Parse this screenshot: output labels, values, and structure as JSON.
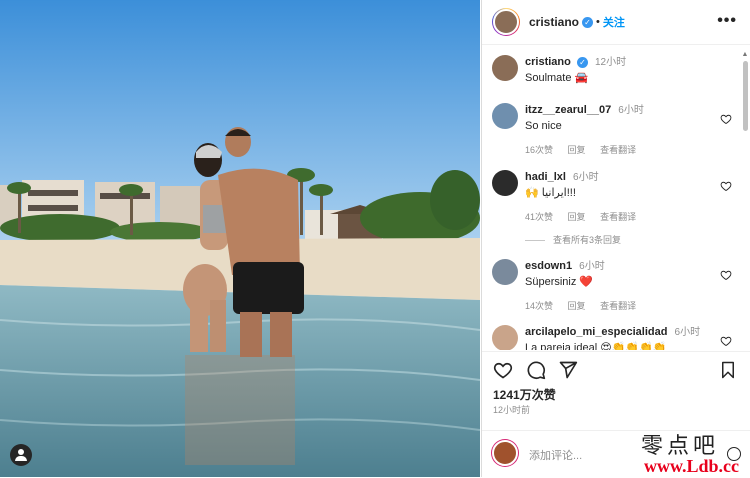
{
  "header": {
    "username": "cristiano",
    "separator": "•",
    "follow_label": "关注",
    "more_icon": "more-horizontal-icon"
  },
  "caption": {
    "username": "cristiano",
    "time": "12小时",
    "text": "Soulmate 🚘"
  },
  "comments": [
    {
      "username": "itzz__zearul__07",
      "time": "6小时",
      "text": "So nice",
      "likes": "16次赞",
      "reply": "回复",
      "translate": "查看翻译"
    },
    {
      "username": "hadi_lxl",
      "time": "6小时",
      "text": "🙌 ايرانيا!!!",
      "likes": "41次赞",
      "reply": "回复",
      "translate": "查看翻译"
    },
    {
      "username": "esdown1",
      "time": "6小时",
      "text": "Süpersiniz ❤️",
      "likes": "14次赞",
      "reply": "回复",
      "translate": "查看翻译"
    },
    {
      "username": "arcilapelo_mi_especialidad",
      "time": "6小时",
      "text": "La pareja ideal 😍👏👏👏👏"
    }
  ],
  "view_replies": "查看所有3条回复",
  "likes_count": "1241万次赞",
  "post_time": "12小时前",
  "add_comment_placeholder": "添加评论...",
  "watermark": {
    "cn": "零点吧",
    "url": "www.Ldb.cc"
  },
  "colors": {
    "accent": "#0095f6",
    "verified": "#3897f0",
    "watermark_red": "#e8001c"
  }
}
